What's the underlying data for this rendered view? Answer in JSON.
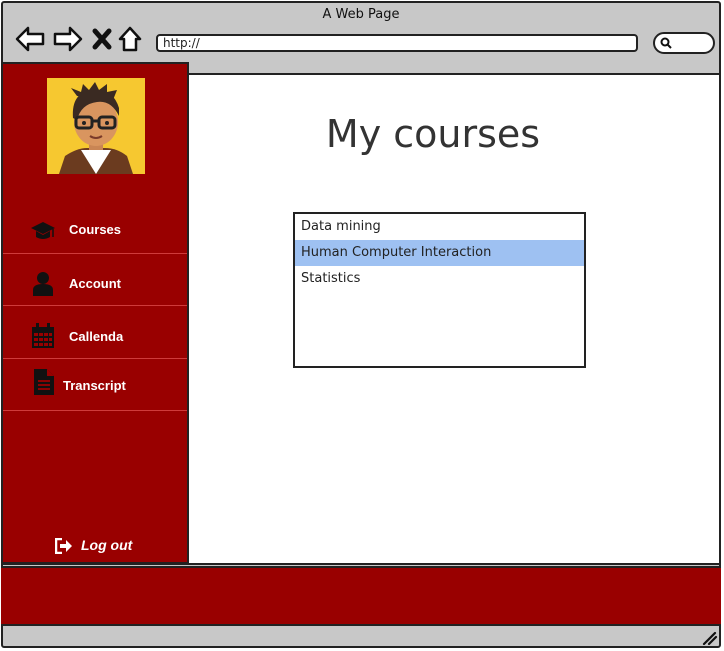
{
  "window": {
    "title": "A Web Page"
  },
  "toolbar": {
    "back_icon": "arrow-left-icon",
    "forward_icon": "arrow-right-icon",
    "close_icon": "x-icon",
    "home_icon": "home-icon",
    "address": "http://",
    "search_icon": "search-icon"
  },
  "sidebar": {
    "items": [
      {
        "label": "Courses",
        "icon": "graduation-cap-icon"
      },
      {
        "label": "Account",
        "icon": "user-icon"
      },
      {
        "label": "Callenda",
        "icon": "calendar-icon"
      },
      {
        "label": "Transcript",
        "icon": "document-icon"
      }
    ],
    "logout_label": "Log out"
  },
  "main": {
    "title": "My courses",
    "courses": [
      "Data mining",
      "Human Computer Interaction",
      "Statistics"
    ],
    "selected_index": 1
  },
  "colors": {
    "sidebar_bg": "#990000",
    "selection": "#9ec1f2",
    "avatar_bg": "#f6c830"
  }
}
